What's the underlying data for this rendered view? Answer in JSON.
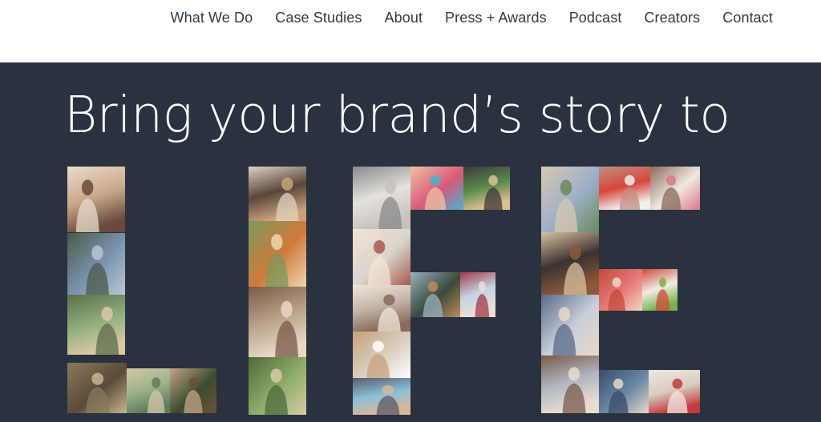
{
  "nav": {
    "items": [
      {
        "label": "What We Do",
        "name": "nav-what-we-do"
      },
      {
        "label": "Case Studies",
        "name": "nav-case-studies"
      },
      {
        "label": "About",
        "name": "nav-about"
      },
      {
        "label": "Press + Awards",
        "name": "nav-press-awards"
      },
      {
        "label": "Podcast",
        "name": "nav-podcast"
      },
      {
        "label": "Creators",
        "name": "nav-creators"
      },
      {
        "label": "Contact",
        "name": "nav-contact"
      }
    ]
  },
  "hero": {
    "headline": "Bring your brand’s story to",
    "collage_word_photo_content": "LIFE",
    "background_color": "#29323e"
  },
  "colors": {
    "nav_text": "#2e3a46",
    "hero_text": "#ffffff"
  }
}
